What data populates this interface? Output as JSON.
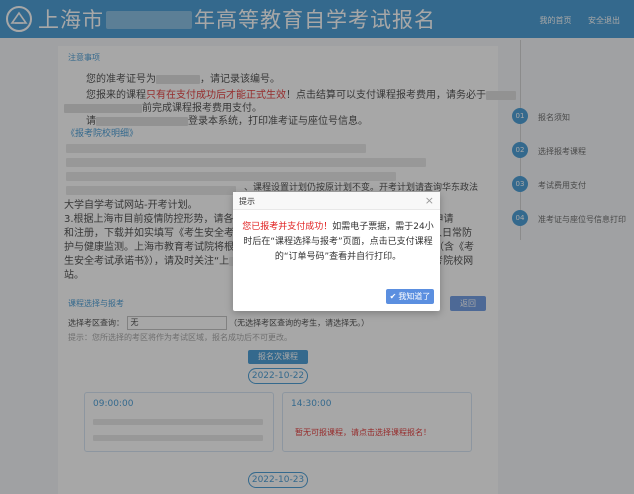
{
  "header": {
    "title_part1": "上海市",
    "title_part2": "年高等教育自学考试报名",
    "links": [
      "我的首页",
      "安全退出"
    ]
  },
  "notice": {
    "section_title": "注意事项",
    "line1_a": "您的准考证号为",
    "line1_b": "，请记录该编号。",
    "line2_a": "您报来的课程",
    "line2_red": "只有在支付成功后才能正式生效",
    "line2_b": "！点击结算可以支付课程报考费用，请务必于",
    "line3_b": "前完成课程报考费用支付。",
    "line4_a": "请",
    "line4_b": "登录本系统，打印准考证与座位号信息。",
    "link_text": "《报考院校明细》",
    "partial_line_a": "、课程设置计划仍按原计划不变。开考计划请查询华东政法",
    "partial_line_b": "大学自学考试网站-开考计划。",
    "item3_a": "3.根据上海市目前疫情防控形势，请各位",
    "item3_b": "申请",
    "item3_line2_a": "和注册，下载并如实填写《考生安全考试",
    "item3_line2_b": "个人日常防",
    "item3_line3_a": "护与健康监测。上海市教育考试院将根据",
    "item3_line3_b": "（含《考",
    "item3_line4_a": "生安全考试承诺书》），请及时关注“上",
    "item3_line4_b": "主考院校网",
    "item3_line5": "站。"
  },
  "form": {
    "section_title": "课程选择与报考",
    "label": "选择考区查询：",
    "select_value": "无",
    "select_hint": "（无选择考区查询的考生，请选择无。）",
    "tip": "提示：您所选择的考区将作为考试区域，报名成功后不可更改。",
    "btn_back": "返回"
  },
  "schedule": {
    "tab": "报名次课程",
    "date1": "2022-10-22",
    "date2": "2022-10-23",
    "slot1_time": "09:00:00",
    "slot2_time": "14:30:00",
    "slot2_hint": "暂无可报课程，请点击选择课程报名！"
  },
  "steps": {
    "labels": [
      "报名须知",
      "选择报考课程",
      "考试费用支付",
      "准考证与座位号信息打印"
    ]
  },
  "dialog": {
    "title": "提示",
    "close_symbol": "×",
    "msg_red": "您已报考并支付成功！",
    "msg_main": "如需电子票据，需于24小时后在“课程选择与报考”页面，点击已支付课程的“订单号码”查看并自行打印。",
    "ok_label": "我知道了",
    "ok_check": "✔"
  },
  "colors": {
    "brand": "#2f8fd0",
    "error": "#e02020",
    "button": "#5b8fe0"
  }
}
